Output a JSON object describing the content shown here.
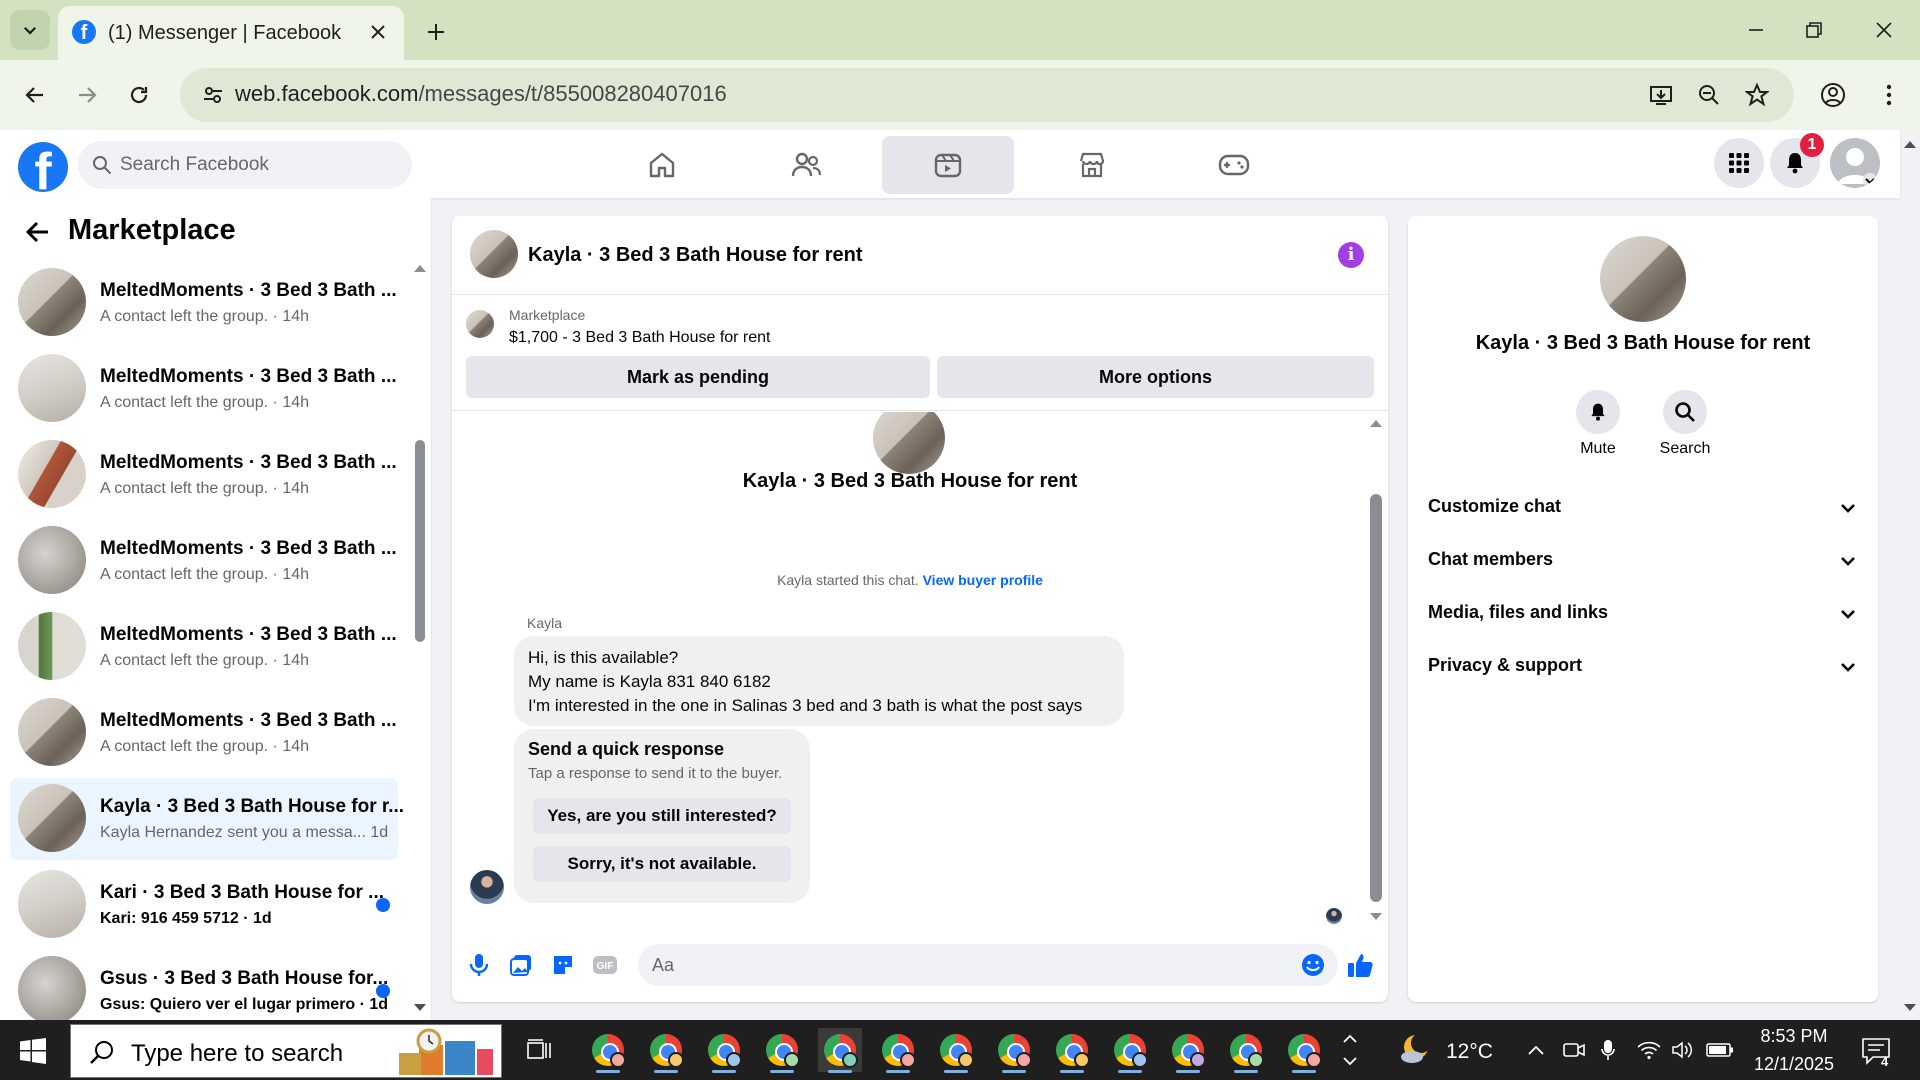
{
  "browser": {
    "tab_title": "(1) Messenger | Facebook",
    "url_host": "web.facebook.com",
    "url_path": "/messages/t/855008280407016"
  },
  "fb": {
    "search_placeholder": "Search Facebook",
    "notifications_count": "1"
  },
  "sidebar": {
    "title": "Marketplace",
    "conversations": [
      {
        "name": "MeltedMoments · 3 Bed 3 Bath ...",
        "preview": "A contact left the group.",
        "time": "14h",
        "unread": false
      },
      {
        "name": "MeltedMoments · 3 Bed 3 Bath ...",
        "preview": "A contact left the group.",
        "time": "14h",
        "unread": false
      },
      {
        "name": "MeltedMoments · 3 Bed 3 Bath ...",
        "preview": "A contact left the group.",
        "time": "14h",
        "unread": false
      },
      {
        "name": "MeltedMoments · 3 Bed 3 Bath ...",
        "preview": "A contact left the group.",
        "time": "14h",
        "unread": false
      },
      {
        "name": "MeltedMoments · 3 Bed 3 Bath ...",
        "preview": "A contact left the group.",
        "time": "14h",
        "unread": false
      },
      {
        "name": "MeltedMoments · 3 Bed 3 Bath ...",
        "preview": "A contact left the group.",
        "time": "14h",
        "unread": false
      },
      {
        "name": "Kayla · 3 Bed 3 Bath House for r...",
        "preview": "Kayla Hernandez sent you a messa...",
        "time": "1d",
        "unread": false,
        "active": true
      },
      {
        "name": "Kari · 3 Bed 3 Bath House for ...",
        "preview": "Kari: 916 459 5712",
        "time": "1d",
        "unread": true
      },
      {
        "name": "Gsus · 3 Bed 3 Bath House for...",
        "preview": "Gsus: Quiero ver el lugar primero",
        "time": "1d",
        "unread": true
      }
    ]
  },
  "chat": {
    "header_name": "Kayla · 3 Bed 3 Bath House for rent",
    "listing_label": "Marketplace",
    "listing_title": "$1,700 - 3 Bed 3 Bath House for rent",
    "mark_pending": "Mark as pending",
    "more_options": "More options",
    "thread_name": "Kayla · 3 Bed 3 Bath House for rent",
    "started_text": "Kayla started this chat.",
    "view_buyer_profile": "View buyer profile",
    "sender_name": "Kayla",
    "message_lines": [
      "Hi, is this available?",
      "My name is Kayla 831 840 6182",
      "I'm interested in the one in Salinas 3 bed and 3 bath is what the post says"
    ],
    "quick_title": "Send a quick response",
    "quick_sub": "Tap a response to send it to the buyer.",
    "quick_yes": "Yes, are you still interested?",
    "quick_sorry": "Sorry, it's not available.",
    "composer_placeholder": "Aa"
  },
  "right_panel": {
    "name": "Kayla · 3 Bed 3 Bath House for rent",
    "mute": "Mute",
    "search": "Search",
    "sections": [
      "Customize chat",
      "Chat members",
      "Media, files and links",
      "Privacy & support"
    ]
  },
  "taskbar": {
    "search_placeholder": "Type here to search",
    "weather": "12°C",
    "time": "8:53 PM",
    "date": "12/1/2025",
    "notif_count": "4"
  },
  "colors": {
    "fb_blue": "#1877f2",
    "accent_purple": "#a33ee5",
    "unread_dot": "#0866ff",
    "chrome_frame": "#d3e3c1"
  }
}
